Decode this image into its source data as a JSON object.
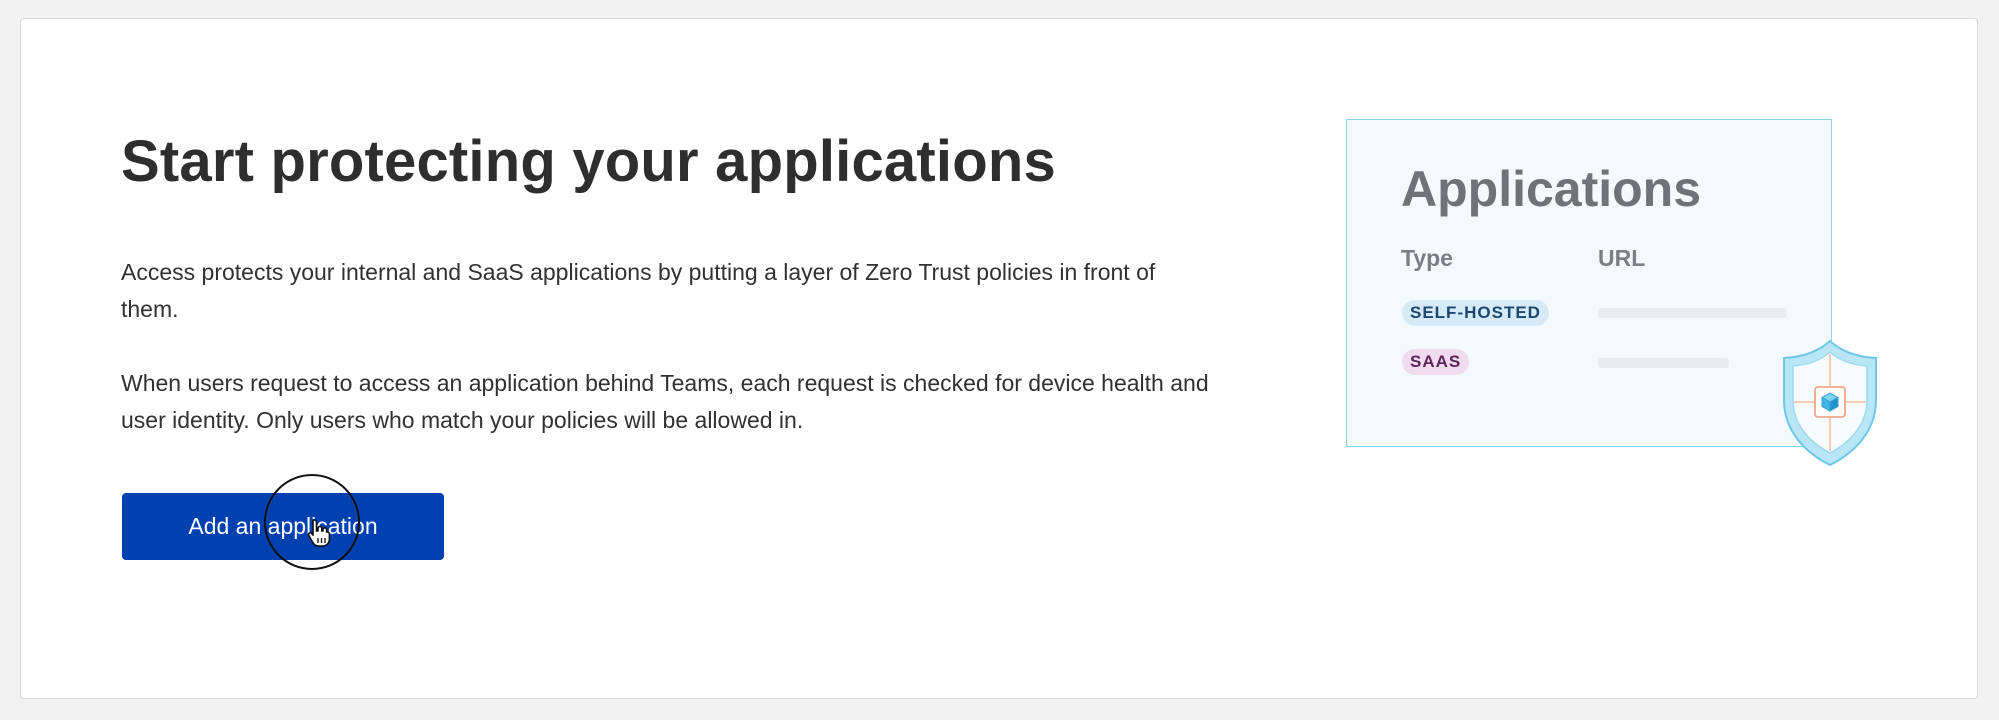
{
  "page": {
    "title": "Start protecting your applications",
    "paragraphs": [
      "Access protects your internal and SaaS applications by putting a layer of Zero Trust policies in front of them.",
      "When users request to access an application behind Teams, each request is checked for device health and user identity. Only users who match your policies will be allowed in."
    ],
    "primary_button_label": "Add an application"
  },
  "illustration": {
    "title": "Applications",
    "columns": [
      "Type",
      "URL"
    ],
    "rows": [
      {
        "type": "SELF-HOSTED"
      },
      {
        "type": "SAAS"
      }
    ],
    "icons": [
      "shield-icon",
      "cube-icon",
      "pointer-hand-icon"
    ]
  },
  "colors": {
    "primary_button": "#0041b1",
    "panel_border": "#8ad4ec",
    "panel_background": "#f3f9fc",
    "self_hosted_tag_bg": "#d7eaf8",
    "saas_tag_bg": "#f0dcee"
  }
}
